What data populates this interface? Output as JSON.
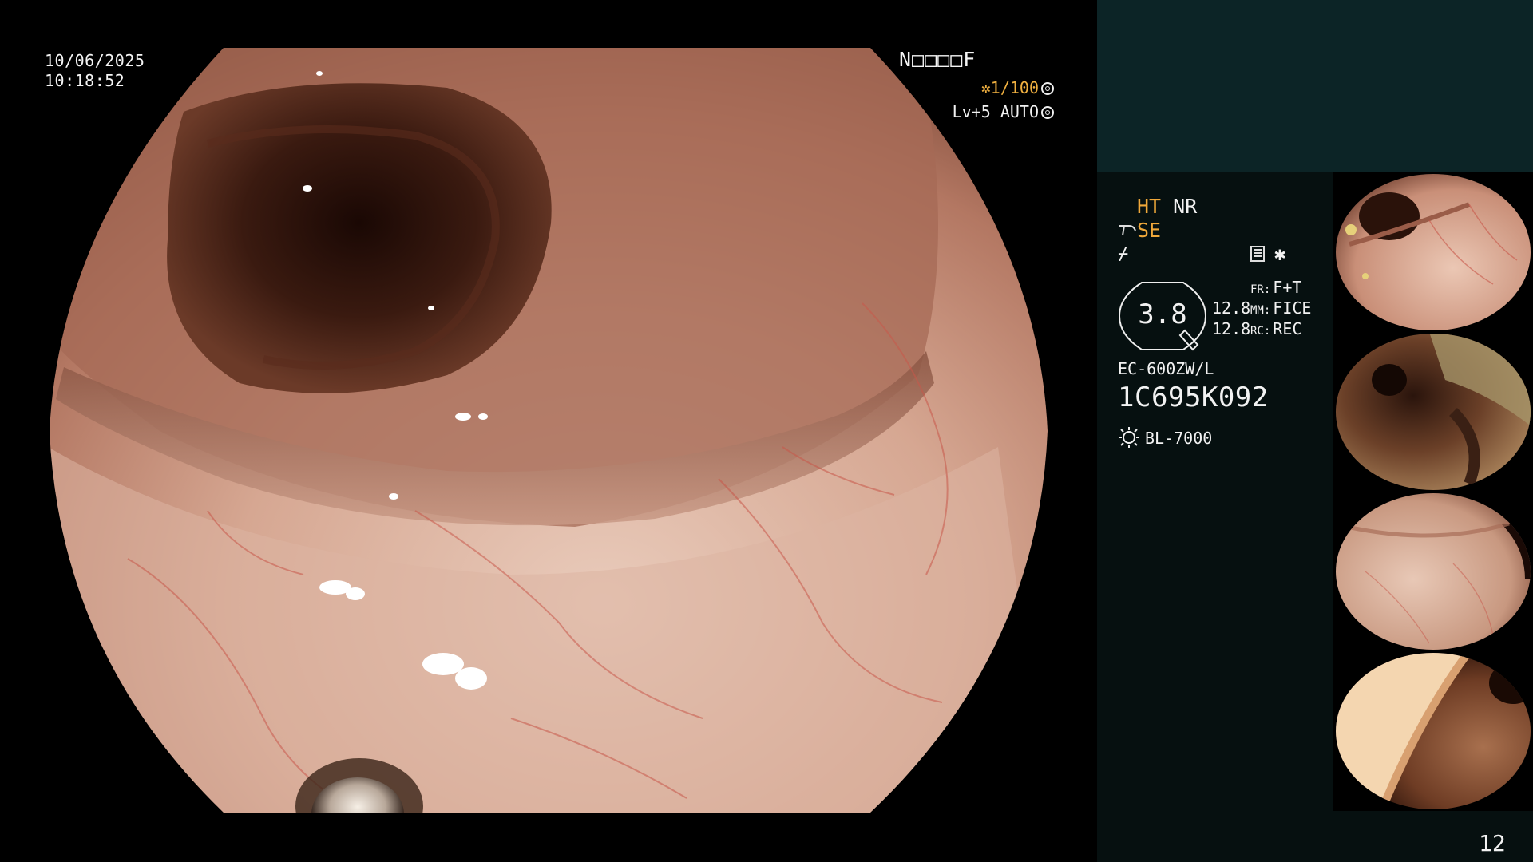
{
  "osd": {
    "date": "10/06/2025",
    "time": "10:18:52",
    "patient_id": "N□□□□F",
    "shutter": "✲1/100",
    "level": "Lv+5 AUTO"
  },
  "panel": {
    "ht": "HT",
    "nr": "NR",
    "se": "SE",
    "enhance_symbol": "⌿",
    "star": "✱",
    "iris_value": "3.8",
    "gain_1": "12.8",
    "gain_2": "12.8",
    "fr_label": "FR:",
    "fr_value": "F+T",
    "mm_label": "MM:",
    "mm_value": "FICE",
    "rc_label": "RC:",
    "rc_value": "REC",
    "scope_model": "EC-600ZW/L",
    "scope_serial": "1C695K092",
    "light_source": "BL-7000"
  },
  "image_count": "12",
  "colors": {
    "panel_top": "#0c2426",
    "panel_body": "#061010",
    "orange_text": "#f0a83a",
    "mucosa_light": "#e7c3b2",
    "mucosa_mid": "#b47a62",
    "lumen_dark": "#241008"
  }
}
